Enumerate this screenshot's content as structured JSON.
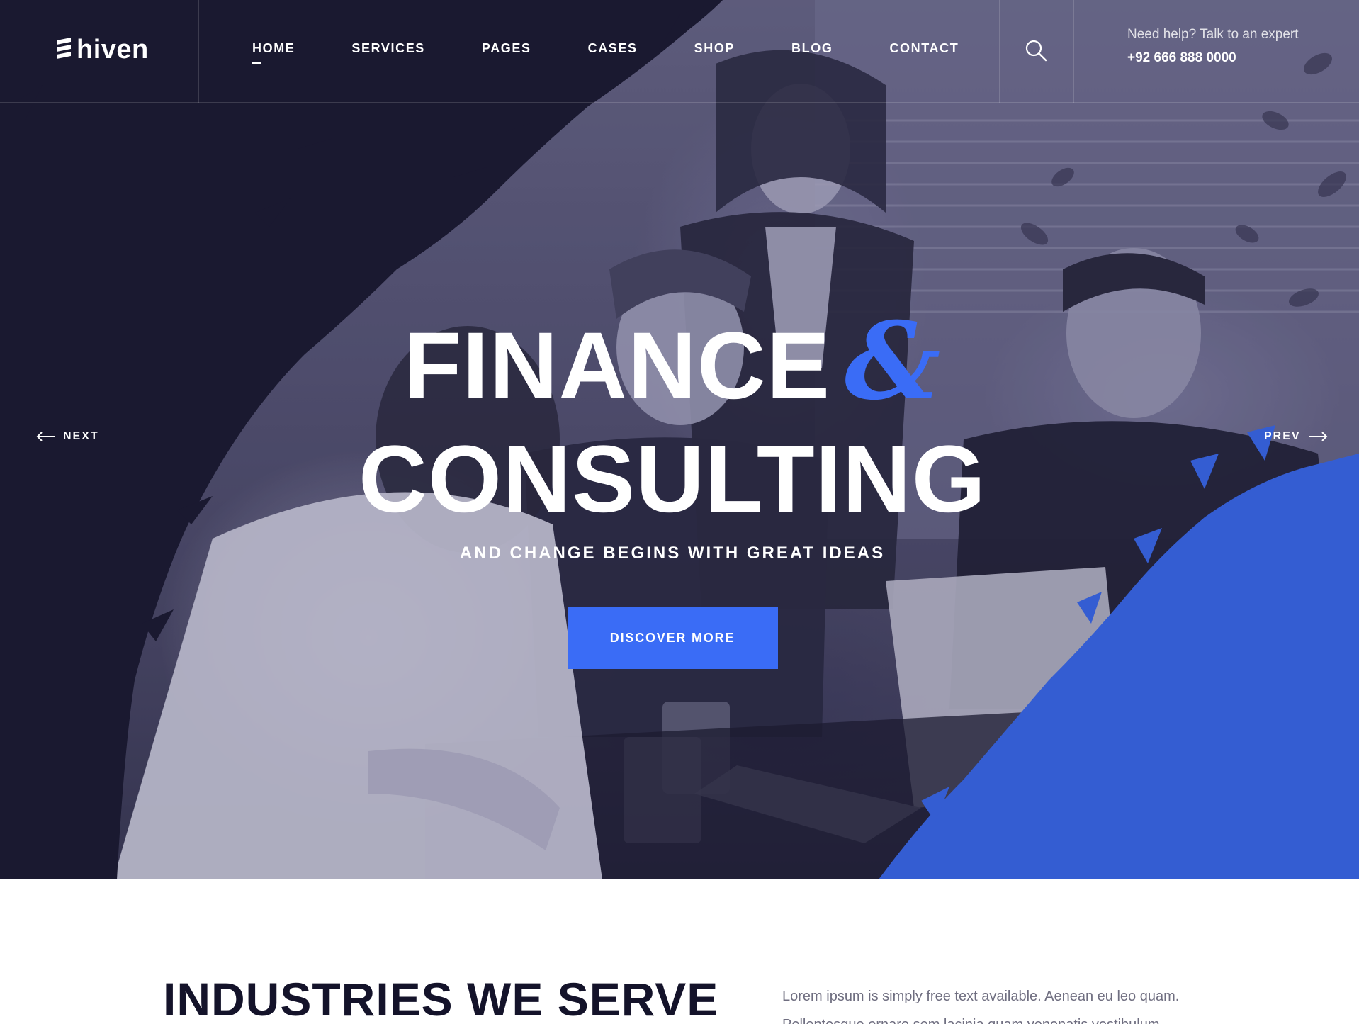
{
  "brand": {
    "name": "hiven",
    "accent_color": "#3a6cf6",
    "dark_color": "#14132a"
  },
  "header": {
    "nav": [
      {
        "label": "HOME",
        "active": true
      },
      {
        "label": "SERVICES",
        "active": false
      },
      {
        "label": "PAGES",
        "active": false
      },
      {
        "label": "CASES",
        "active": false
      },
      {
        "label": "SHOP",
        "active": false
      },
      {
        "label": "BLOG",
        "active": false
      },
      {
        "label": "CONTACT",
        "active": false
      }
    ],
    "search_icon": "search-icon",
    "help_label": "Need help? Talk to an expert",
    "help_phone": "+92 666 888 0000"
  },
  "hero": {
    "title_line1": "FINANCE",
    "title_amp": "&",
    "title_line2": "CONSULTING",
    "subtitle": "AND CHANGE BEGINS WITH GREAT IDEAS",
    "cta_label": "DISCOVER MORE",
    "next_label": "NEXT",
    "prev_label": "PREV",
    "next_icon": "arrow-left-icon",
    "prev_icon": "arrow-right-icon"
  },
  "industries": {
    "title": "INDUSTRIES WE SERVE",
    "text": "Lorem ipsum is simply free text available. Aenean eu leo quam. Pellentesque ornare sem lacinia quam venenatis vestibulum."
  }
}
